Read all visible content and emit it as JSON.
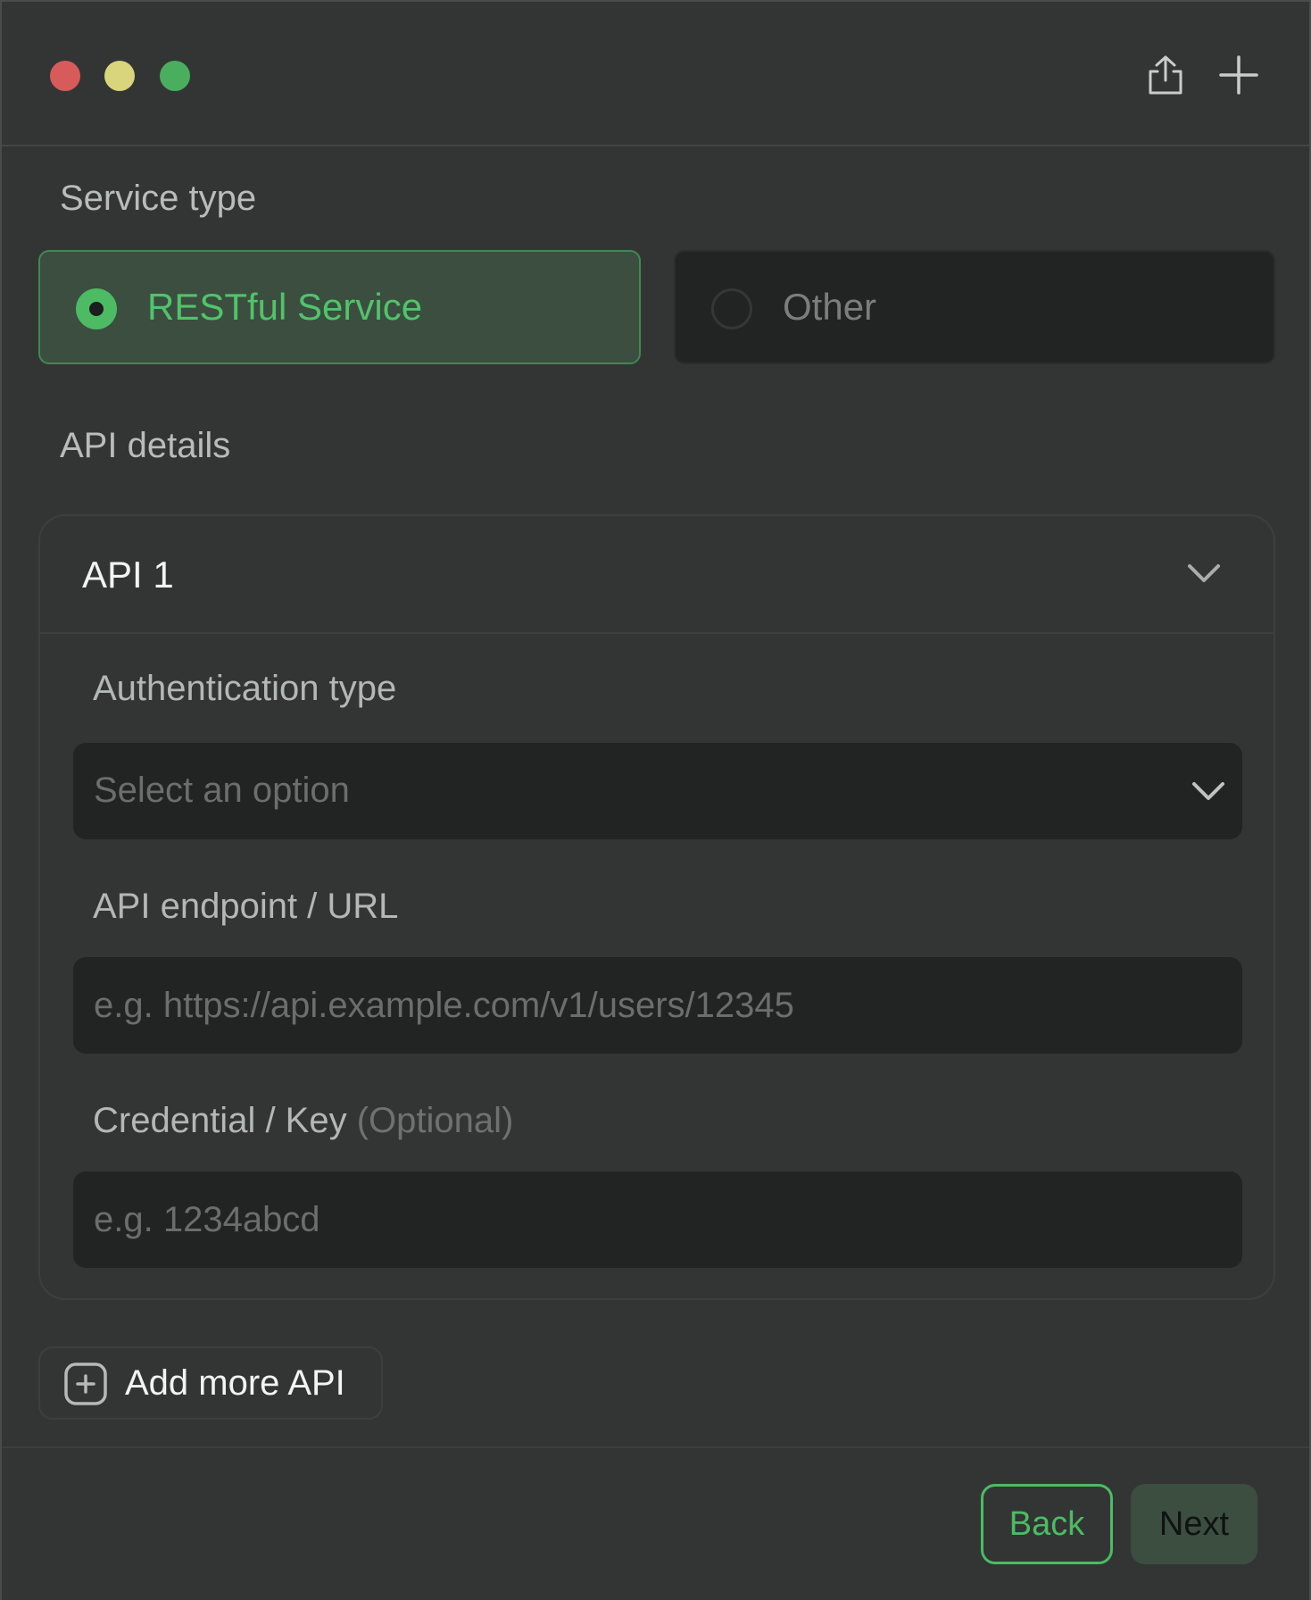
{
  "window": {
    "toolbar": {
      "share_icon": "share-icon",
      "add_icon": "plus-icon"
    }
  },
  "service_type": {
    "label": "Service type",
    "options": [
      {
        "label": "RESTful Service",
        "selected": true
      },
      {
        "label": "Other",
        "selected": false
      }
    ]
  },
  "api_details": {
    "label": "API details",
    "apis": [
      {
        "title": "API 1",
        "auth_type": {
          "label": "Authentication type",
          "placeholder": "Select an option"
        },
        "endpoint": {
          "label": "API endpoint / URL",
          "placeholder": "e.g. https://api.example.com/v1/users/12345"
        },
        "credential": {
          "label": "Credential / Key",
          "optional": "(Optional)",
          "placeholder": "e.g. 1234abcd"
        }
      }
    ],
    "add_more_label": "Add more API"
  },
  "footer": {
    "back_label": "Back",
    "next_label": "Next"
  },
  "colors": {
    "accent": "#4cbb63",
    "accent_bg": "#3b4e40",
    "background": "#333535",
    "field_bg": "#222323"
  }
}
